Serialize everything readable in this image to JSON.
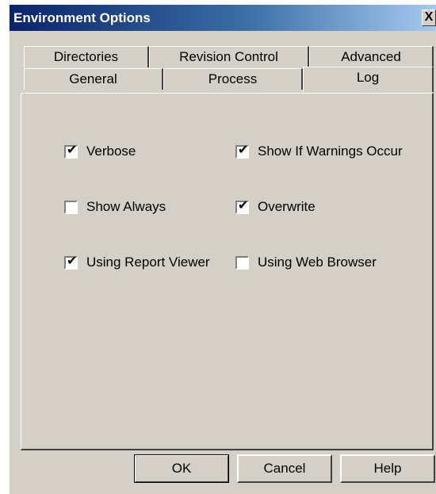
{
  "window": {
    "title": "Environment Options",
    "close_label": "X"
  },
  "tabs": {
    "back_row": [
      "Directories",
      "Revision Control",
      "Advanced"
    ],
    "front_row": [
      "General",
      "Process",
      "Log"
    ],
    "active": "Log"
  },
  "options": [
    {
      "label": "Verbose",
      "checked": true
    },
    {
      "label": "Show If Warnings Occur",
      "checked": true
    },
    {
      "label": "Show Always",
      "checked": false
    },
    {
      "label": "Overwrite",
      "checked": true
    },
    {
      "label": "Using Report Viewer",
      "checked": true
    },
    {
      "label": "Using Web Browser",
      "checked": false
    }
  ],
  "buttons": {
    "ok": "OK",
    "cancel": "Cancel",
    "help": "Help"
  }
}
